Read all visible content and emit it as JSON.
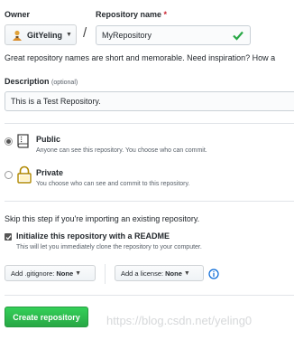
{
  "owner": {
    "label": "Owner",
    "value": "GitYeling"
  },
  "repository": {
    "label": "Repository name",
    "required_mark": "*",
    "value": "MyRepository"
  },
  "help_text": "Great repository names are short and memorable. Need inspiration? How a",
  "description": {
    "label": "Description",
    "optional": "(optional)",
    "value": "This is a Test Repository."
  },
  "visibility": {
    "public": {
      "title": "Public",
      "desc": "Anyone can see this repository. You choose who can commit.",
      "selected": true
    },
    "private": {
      "title": "Private",
      "desc": "You choose who can see and commit to this repository.",
      "selected": false
    }
  },
  "skip_text": "Skip this step if you're importing an existing repository.",
  "readme": {
    "label": "Initialize this repository with a README",
    "desc": "This will let you immediately clone the repository to your computer.",
    "checked": true
  },
  "gitignore": {
    "prefix": "Add .gitignore:",
    "value": "None"
  },
  "license": {
    "prefix": "Add a license:",
    "value": "None"
  },
  "create_button": "Create repository",
  "watermark": "https://blog.csdn.net/yeling0",
  "colors": {
    "primary_button": "#28a745",
    "check": "#28a745",
    "info": "#0366d6"
  }
}
